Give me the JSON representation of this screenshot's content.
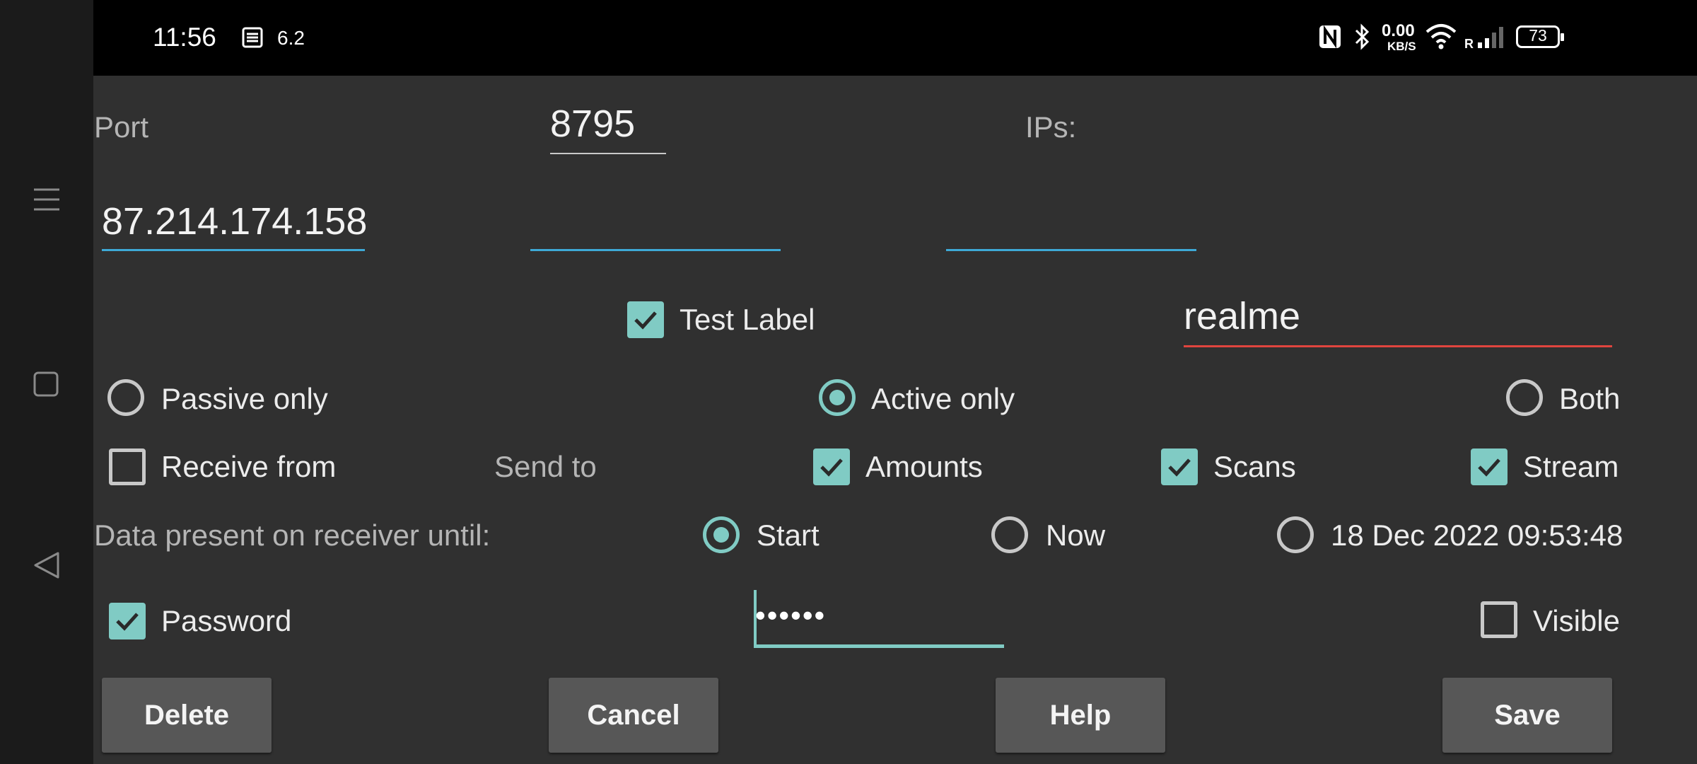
{
  "status_bar": {
    "time": "11:56",
    "notification_value": "6.2",
    "data_speed": "0.00",
    "data_unit": "KB/S",
    "roaming": "R",
    "battery": "73"
  },
  "form": {
    "port_label": "Port",
    "port_value": "8795",
    "ips_label": "IPs:",
    "ip_value": "87.214.174.158",
    "test_label_checkbox": "Test Label",
    "test_label_checked": true,
    "device_name": "realme",
    "mode_options": [
      {
        "label": "Passive only",
        "selected": false
      },
      {
        "label": "Active only",
        "selected": true
      },
      {
        "label": "Both",
        "selected": false
      }
    ],
    "receive_from_label": "Receive from",
    "receive_from_checked": false,
    "send_to_label": "Send to",
    "send_amounts_label": "Amounts",
    "send_amounts_checked": true,
    "send_scans_label": "Scans",
    "send_scans_checked": true,
    "send_stream_label": "Stream",
    "send_stream_checked": true,
    "data_present_label": "Data present on receiver until:",
    "until_options": [
      {
        "label": "Start",
        "selected": true
      },
      {
        "label": "Now",
        "selected": false
      },
      {
        "label": "18 Dec 2022 09:53:48",
        "selected": false
      }
    ],
    "password_label": "Password",
    "password_checked": true,
    "password_mask": "••••••",
    "visible_label": "Visible",
    "visible_checked": false
  },
  "buttons": {
    "delete": "Delete",
    "cancel": "Cancel",
    "help": "Help",
    "save": "Save"
  },
  "colors": {
    "accent": "#80cbc4",
    "underline_blue": "#3ea9d6",
    "error_red": "#e0443e",
    "background": "#303030"
  }
}
